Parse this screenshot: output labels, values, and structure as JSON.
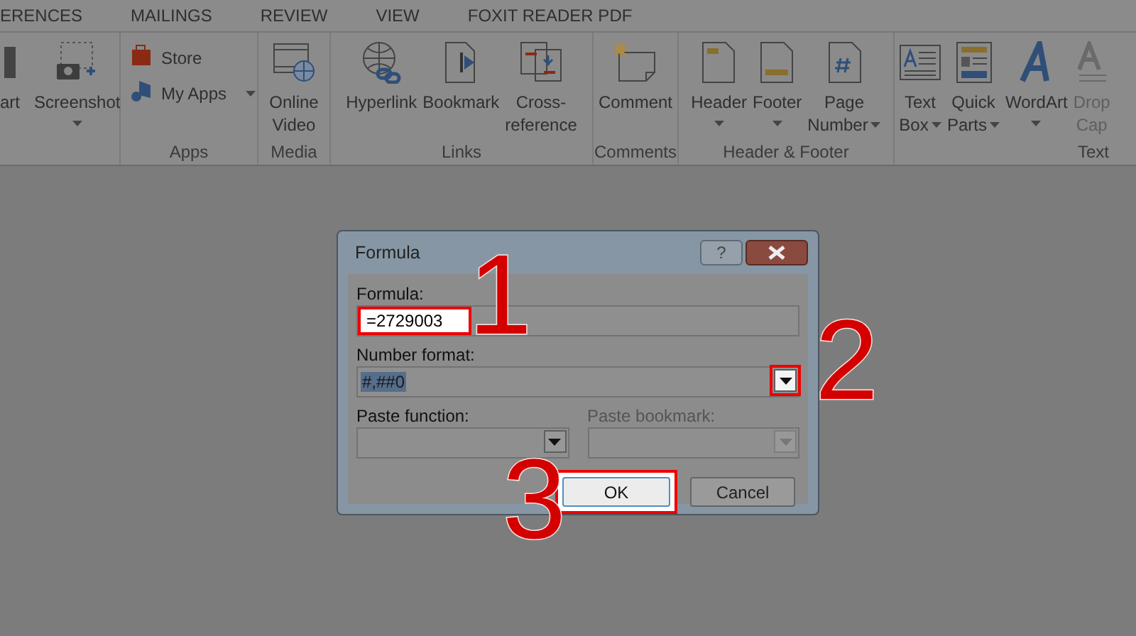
{
  "tabs": [
    {
      "label": "ERENCES"
    },
    {
      "label": "MAILINGS"
    },
    {
      "label": "REVIEW"
    },
    {
      "label": "VIEW"
    },
    {
      "label": "FOXIT READER PDF"
    }
  ],
  "ribbon": {
    "groups": [
      {
        "items": [
          {
            "kind": "large",
            "lines": [
              "art"
            ],
            "dropdown": false
          },
          {
            "kind": "large",
            "lines": [
              "Screenshot"
            ],
            "dropdown": true
          }
        ]
      },
      {
        "label": "Apps",
        "items": [
          {
            "kind": "small",
            "lines": [
              "Store"
            ],
            "dropdown": false
          },
          {
            "kind": "small",
            "lines": [
              "My Apps"
            ],
            "dropdown": true
          }
        ]
      },
      {
        "label": "Media",
        "items": [
          {
            "kind": "large",
            "lines": [
              "Online",
              "Video"
            ],
            "dropdown": false
          }
        ]
      },
      {
        "label": "Links",
        "items": [
          {
            "kind": "large",
            "lines": [
              "Hyperlink"
            ],
            "dropdown": false
          },
          {
            "kind": "large",
            "lines": [
              "Bookmark"
            ],
            "dropdown": false
          },
          {
            "kind": "large",
            "lines": [
              "Cross-",
              "reference"
            ],
            "dropdown": false
          }
        ]
      },
      {
        "label": "Comments",
        "items": [
          {
            "kind": "large",
            "lines": [
              "Comment"
            ],
            "dropdown": false
          }
        ]
      },
      {
        "label": "Header & Footer",
        "items": [
          {
            "kind": "large",
            "lines": [
              "Header"
            ],
            "dropdown": true
          },
          {
            "kind": "large",
            "lines": [
              "Footer"
            ],
            "dropdown": true
          },
          {
            "kind": "large",
            "lines": [
              "Page",
              "Number"
            ],
            "dropdown": true
          }
        ]
      },
      {
        "label": "Text",
        "items": [
          {
            "kind": "large",
            "lines": [
              "Text",
              "Box"
            ],
            "dropdown": true
          },
          {
            "kind": "large",
            "lines": [
              "Quick",
              "Parts"
            ],
            "dropdown": true
          },
          {
            "kind": "large",
            "lines": [
              "WordArt"
            ],
            "dropdown": true
          },
          {
            "kind": "large",
            "lines": [
              "Drop",
              "Cap"
            ],
            "dropdown": false
          }
        ]
      }
    ]
  },
  "dialog": {
    "title": "Formula",
    "help_button": "?",
    "formula": {
      "label": "Formula:",
      "value": "=2729003",
      "highlighted": true
    },
    "number_format": {
      "label": "Number format:",
      "value": "#,##0",
      "highlighted": true
    },
    "paste_function": {
      "label": "Paste function:",
      "disabled": false
    },
    "paste_bookmark": {
      "label": "Paste bookmark:",
      "disabled": true
    },
    "buttons": [
      {
        "label": "OK",
        "highlighted": true
      },
      {
        "label": "Cancel",
        "highlighted": false
      }
    ]
  },
  "annotations": [
    {
      "label": "1"
    },
    {
      "label": "2"
    },
    {
      "label": "3"
    }
  ]
}
